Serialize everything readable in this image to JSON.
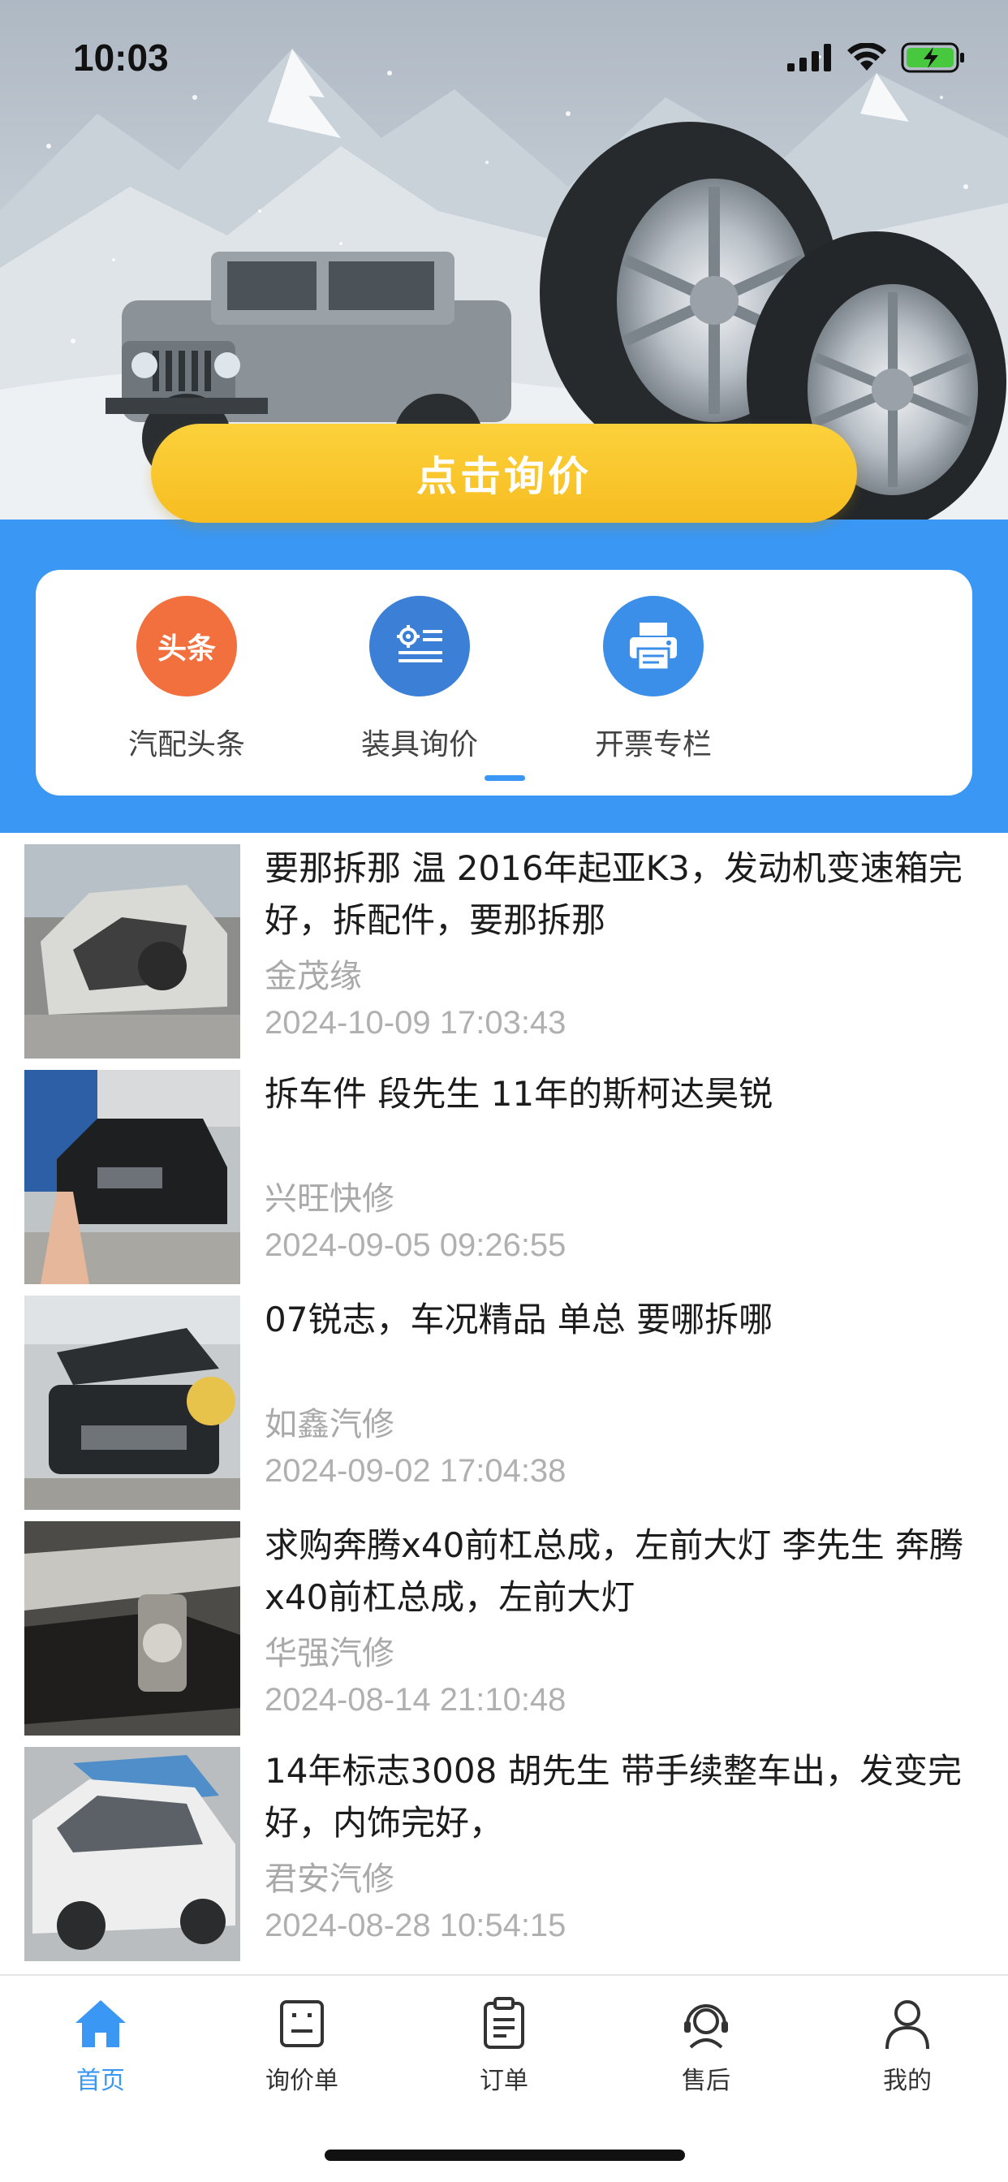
{
  "status_bar": {
    "time": "10:03"
  },
  "hero": {
    "cta_label": "点击询价"
  },
  "quick_menu": [
    {
      "label": "汽配头条",
      "icon": "headline-icon",
      "badge_text": "头条",
      "color": "#f2703d"
    },
    {
      "label": "装具询价",
      "icon": "settings-list-icon",
      "color": "#3b7fd6"
    },
    {
      "label": "开票专栏",
      "icon": "printer-icon",
      "color": "#3b8fe8"
    }
  ],
  "news": [
    {
      "title": "要那拆那 温 2016年起亚K3，发动机变速箱完好，拆配件，要那拆那",
      "source": "金茂缘",
      "date": "2024-10-09 17:03:43"
    },
    {
      "title": "拆车件 段先生 11年的斯柯达昊锐",
      "source": "兴旺快修",
      "date": "2024-09-05 09:26:55"
    },
    {
      "title": "07锐志，车况精品 单总 要哪拆哪",
      "source": "如鑫汽修",
      "date": "2024-09-02 17:04:38"
    },
    {
      "title": "求购奔腾x40前杠总成，左前大灯 李先生 奔腾x40前杠总成，左前大灯",
      "source": "华强汽修",
      "date": "2024-08-14 21:10:48"
    },
    {
      "title": "14年标志3008 胡先生 带手续整车出，发变完好，内饰完好，",
      "source": "君安汽修",
      "date": "2024-08-28 10:54:15"
    }
  ],
  "tabs": [
    {
      "label": "首页",
      "icon": "home-icon",
      "active": true
    },
    {
      "label": "询价单",
      "icon": "inquiry-icon",
      "active": false
    },
    {
      "label": "订单",
      "icon": "order-icon",
      "active": false
    },
    {
      "label": "售后",
      "icon": "after-sales-icon",
      "active": false
    },
    {
      "label": "我的",
      "icon": "profile-icon",
      "active": false
    }
  ],
  "colors": {
    "brand_blue": "#3a97f3",
    "cta_yellow": "#f8c52b"
  }
}
